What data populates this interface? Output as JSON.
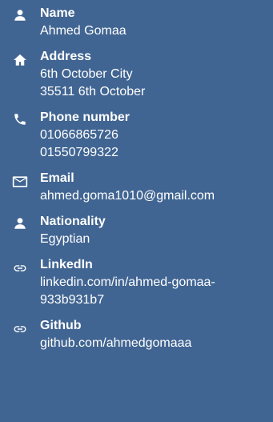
{
  "contact": {
    "name": {
      "label": "Name",
      "icon": "person-icon",
      "values": [
        "Ahmed Gomaa"
      ]
    },
    "address": {
      "label": "Address",
      "icon": "home-icon",
      "values": [
        "6th October City",
        "35511 6th October"
      ]
    },
    "phone": {
      "label": "Phone number",
      "icon": "phone-icon",
      "values": [
        "01066865726",
        "01550799322"
      ]
    },
    "email": {
      "label": "Email",
      "icon": "mail-icon",
      "values": [
        "ahmed.goma1010@gmail.com"
      ]
    },
    "nationality": {
      "label": "Nationality",
      "icon": "person-icon",
      "values": [
        "Egyptian"
      ]
    },
    "linkedin": {
      "label": "LinkedIn",
      "icon": "link-icon",
      "values": [
        "linkedin.com/in/ahmed-gomaa-933b931b7"
      ]
    },
    "github": {
      "label": "Github",
      "icon": "link-icon",
      "values": [
        "github.com/ahmedgomaaa"
      ]
    }
  },
  "colors": {
    "background": "#416592",
    "text": "#ffffff"
  }
}
